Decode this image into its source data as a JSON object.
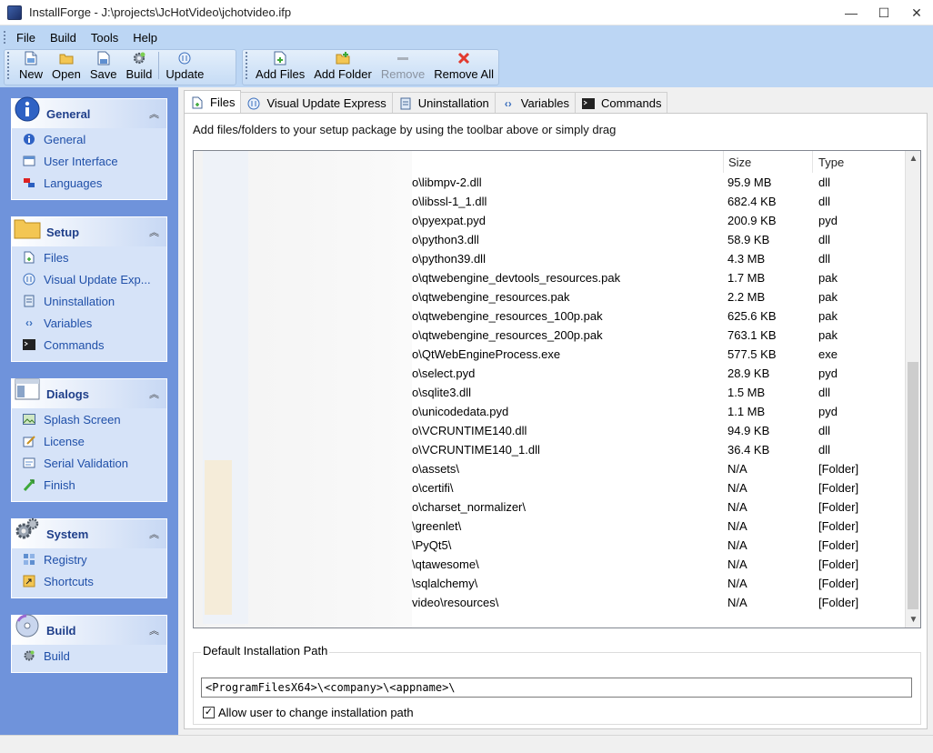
{
  "window": {
    "title": "InstallForge - J:\\projects\\JcHotVideo\\jchotvideo.ifp",
    "minimize": "—",
    "maximize": "☐",
    "close": "✕"
  },
  "menu": [
    "File",
    "Build",
    "Tools",
    "Help"
  ],
  "toolbar": {
    "new_label": "New",
    "open_label": "Open",
    "save_label": "Save",
    "build_label": "Build",
    "update_label": "Update",
    "add_files_label": "Add Files",
    "add_folder_label": "Add Folder",
    "remove_label": "Remove",
    "remove_all_label": "Remove All"
  },
  "sidebar": {
    "general": {
      "title": "General",
      "items": [
        "General",
        "User Interface",
        "Languages"
      ]
    },
    "setup": {
      "title": "Setup",
      "items": [
        "Files",
        "Visual Update Exp...",
        "Uninstallation",
        "Variables",
        "Commands"
      ]
    },
    "dialogs": {
      "title": "Dialogs",
      "items": [
        "Splash Screen",
        "License",
        "Serial Validation",
        "Finish"
      ]
    },
    "system": {
      "title": "System",
      "items": [
        "Registry",
        "Shortcuts"
      ]
    },
    "build": {
      "title": "Build",
      "items": [
        "Build"
      ]
    }
  },
  "tabs": [
    "Files",
    "Visual Update Express",
    "Uninstallation",
    "Variables",
    "Commands"
  ],
  "main": {
    "hint": "Add files/folders to your setup package by using the toolbar above or simply drag",
    "columns": {
      "size": "Size",
      "type": "Type"
    },
    "files": [
      {
        "path": "o\\libmpv-2.dll",
        "size": "95.9 MB",
        "type": "dll"
      },
      {
        "path": "o\\libssl-1_1.dll",
        "size": "682.4 KB",
        "type": "dll"
      },
      {
        "path": "o\\pyexpat.pyd",
        "size": "200.9 KB",
        "type": "pyd"
      },
      {
        "path": "o\\python3.dll",
        "size": "58.9 KB",
        "type": "dll"
      },
      {
        "path": "o\\python39.dll",
        "size": "4.3 MB",
        "type": "dll"
      },
      {
        "path": "o\\qtwebengine_devtools_resources.pak",
        "size": "1.7 MB",
        "type": "pak"
      },
      {
        "path": "o\\qtwebengine_resources.pak",
        "size": "2.2 MB",
        "type": "pak"
      },
      {
        "path": "o\\qtwebengine_resources_100p.pak",
        "size": "625.6 KB",
        "type": "pak"
      },
      {
        "path": "o\\qtwebengine_resources_200p.pak",
        "size": "763.1 KB",
        "type": "pak"
      },
      {
        "path": "o\\QtWebEngineProcess.exe",
        "size": "577.5 KB",
        "type": "exe"
      },
      {
        "path": "o\\select.pyd",
        "size": "28.9 KB",
        "type": "pyd"
      },
      {
        "path": "o\\sqlite3.dll",
        "size": "1.5 MB",
        "type": "dll"
      },
      {
        "path": "o\\unicodedata.pyd",
        "size": "1.1 MB",
        "type": "pyd"
      },
      {
        "path": "o\\VCRUNTIME140.dll",
        "size": "94.9 KB",
        "type": "dll"
      },
      {
        "path": "o\\VCRUNTIME140_1.dll",
        "size": "36.4 KB",
        "type": "dll"
      },
      {
        "path": "o\\assets\\",
        "size": "N/A",
        "type": "[Folder]"
      },
      {
        "path": "o\\certifi\\",
        "size": "N/A",
        "type": "[Folder]"
      },
      {
        "path": "o\\charset_normalizer\\",
        "size": "N/A",
        "type": "[Folder]"
      },
      {
        "path": "\\greenlet\\",
        "size": "N/A",
        "type": "[Folder]"
      },
      {
        "path": "\\PyQt5\\",
        "size": "N/A",
        "type": "[Folder]"
      },
      {
        "path": "\\qtawesome\\",
        "size": "N/A",
        "type": "[Folder]"
      },
      {
        "path": "\\sqlalchemy\\",
        "size": "N/A",
        "type": "[Folder]"
      },
      {
        "path": "video\\resources\\",
        "size": "N/A",
        "type": "[Folder]"
      }
    ],
    "install_path_label": "Default Installation Path",
    "install_path_value": "<ProgramFilesX64>\\<company>\\<appname>\\",
    "allow_change_label": "Allow user to change installation path",
    "allow_change_checked": "✓"
  }
}
